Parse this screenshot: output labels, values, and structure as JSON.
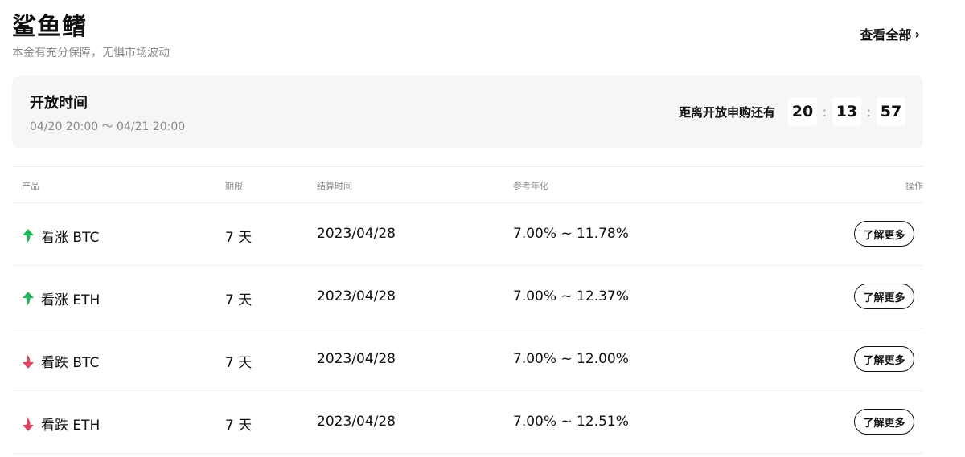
{
  "header": {
    "title": "鲨鱼鳍",
    "subtitle": "本金有充分保障，无惧市场波动",
    "view_all": "查看全部",
    "view_all_icon": "chevron-right-icon"
  },
  "open_time": {
    "label": "开放时间",
    "range": "04/20 20:00 ～ 04/21 20:00",
    "countdown_label": "距离开放申购还有",
    "hours": "20",
    "minutes": "13",
    "seconds": "57",
    "separator": ":"
  },
  "table": {
    "headers": [
      "产品",
      "期限",
      "结算时间",
      "参考年化",
      "操作"
    ],
    "rows": [
      {
        "direction": "up",
        "product": "看涨 BTC",
        "term": "7 天",
        "settle": "2023/04/28",
        "rate": "7.00% ~ 11.78%",
        "action": "了解更多"
      },
      {
        "direction": "up",
        "product": "看涨 ETH",
        "term": "7 天",
        "settle": "2023/04/28",
        "rate": "7.00% ~ 12.37%",
        "action": "了解更多"
      },
      {
        "direction": "down",
        "product": "看跌 BTC",
        "term": "7 天",
        "settle": "2023/04/28",
        "rate": "7.00% ~ 12.00%",
        "action": "了解更多"
      },
      {
        "direction": "down",
        "product": "看跌 ETH",
        "term": "7 天",
        "settle": "2023/04/28",
        "rate": "7.00% ~ 12.51%",
        "action": "了解更多"
      }
    ]
  },
  "colors": {
    "up": "#1fb85a",
    "down": "#e0475f"
  }
}
